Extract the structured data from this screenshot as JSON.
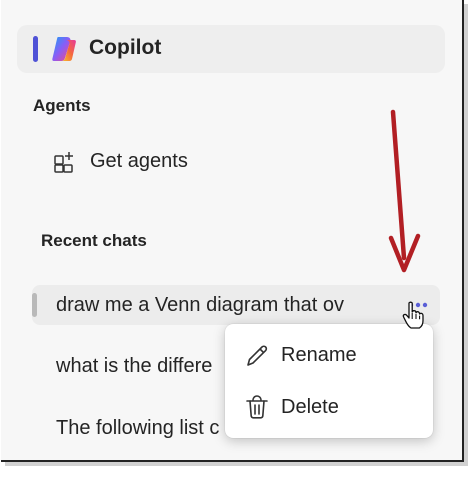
{
  "sidebar": {
    "copilot": {
      "label": "Copilot"
    },
    "agents": {
      "heading": "Agents",
      "get_agents_label": "Get agents"
    },
    "recent": {
      "heading": "Recent chats",
      "chats": [
        {
          "title": "draw me a Venn diagram that ov",
          "selected": true
        },
        {
          "title": "what is the differe",
          "selected": false
        },
        {
          "title": "The following list c",
          "selected": false
        }
      ]
    }
  },
  "context_menu": {
    "items": [
      {
        "label": "Rename",
        "icon": "pencil-icon"
      },
      {
        "label": "Delete",
        "icon": "trash-icon"
      }
    ]
  },
  "annotation": {
    "arrow_color": "#b21f24"
  },
  "colors": {
    "accent": "#4f52d6",
    "selection": "#ececec",
    "background": "#f7f7f7"
  }
}
